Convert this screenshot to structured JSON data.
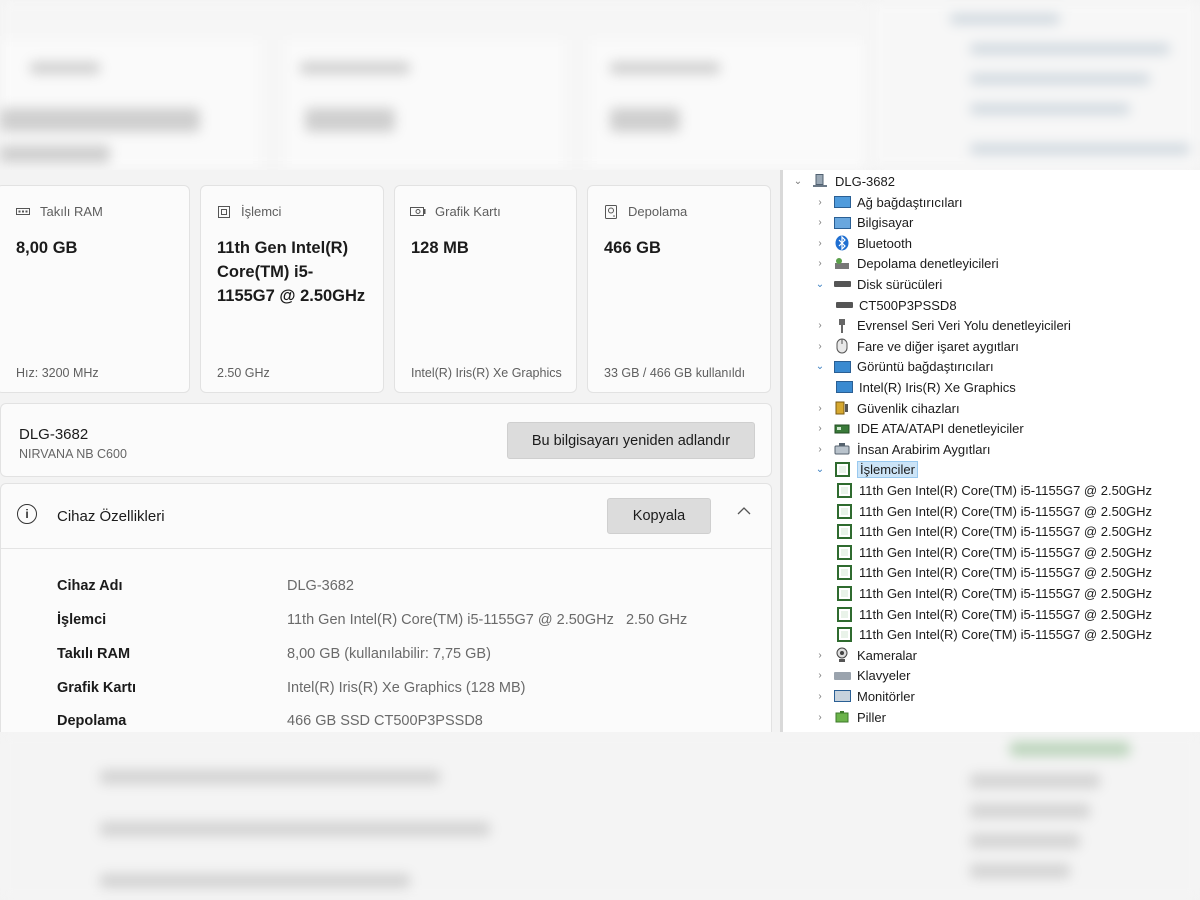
{
  "cards": [
    {
      "icon": "ram-icon",
      "label": "Takılı RAM",
      "value": "8,00 GB",
      "footer": "Hız: 3200 MHz"
    },
    {
      "icon": "processor-icon",
      "label": "İşlemci",
      "value": "11th Gen Intel(R) Core(TM) i5-1155G7 @ 2.50GHz",
      "footer": "2.50 GHz"
    },
    {
      "icon": "graphics-card-icon",
      "label": "Grafik Kartı",
      "value": "128 MB",
      "footer": "Intel(R) Iris(R) Xe Graphics"
    },
    {
      "icon": "storage-icon",
      "label": "Depolama",
      "value": "466 GB",
      "footer": "33 GB / 466 GB kullanıldı"
    }
  ],
  "device": {
    "name": "DLG-3682",
    "model": "NIRVANA NB C600",
    "rename_label": "Bu bilgisayarı yeniden adlandır"
  },
  "specs": {
    "title": "Cihaz Özellikleri",
    "copy_label": "Kopyala",
    "rows": [
      {
        "key": "Cihaz Adı",
        "value": "DLG-3682"
      },
      {
        "key": "İşlemci",
        "value": "11th Gen Intel(R) Core(TM) i5-1155G7 @ 2.50GHz   2.50 GHz"
      },
      {
        "key": "Takılı RAM",
        "value": "8,00 GB (kullanılabilir: 7,75 GB)"
      },
      {
        "key": "Grafik Kartı",
        "value": "Intel(R) Iris(R) Xe Graphics (128 MB)"
      },
      {
        "key": "Depolama",
        "value": "466 GB SSD CT500P3PSSD8"
      }
    ]
  },
  "device_manager": {
    "root": "DLG-3682",
    "items": [
      {
        "label": "Ağ bağdaştırıcıları",
        "level": 1,
        "expanded": false,
        "icon": "network-adapter-icon"
      },
      {
        "label": "Bilgisayar",
        "level": 1,
        "expanded": false,
        "icon": "computer-icon"
      },
      {
        "label": "Bluetooth",
        "level": 1,
        "expanded": false,
        "icon": "bluetooth-icon"
      },
      {
        "label": "Depolama denetleyicileri",
        "level": 1,
        "expanded": false,
        "icon": "storage-controller-icon"
      },
      {
        "label": "Disk sürücüleri",
        "level": 1,
        "expanded": true,
        "icon": "disk-drive-icon"
      },
      {
        "label": "CT500P3PSSD8",
        "level": 2,
        "icon": "disk-drive-icon"
      },
      {
        "label": "Evrensel Seri Veri Yolu denetleyicileri",
        "level": 1,
        "expanded": false,
        "icon": "usb-icon"
      },
      {
        "label": "Fare ve diğer işaret aygıtları",
        "level": 1,
        "expanded": false,
        "icon": "mouse-icon"
      },
      {
        "label": "Görüntü bağdaştırıcıları",
        "level": 1,
        "expanded": true,
        "icon": "display-adapter-icon"
      },
      {
        "label": "Intel(R) Iris(R) Xe Graphics",
        "level": 2,
        "icon": "display-adapter-icon"
      },
      {
        "label": "Güvenlik cihazları",
        "level": 1,
        "expanded": false,
        "icon": "security-device-icon"
      },
      {
        "label": "IDE ATA/ATAPI denetleyiciler",
        "level": 1,
        "expanded": false,
        "icon": "ide-controller-icon"
      },
      {
        "label": "İnsan Arabirim Aygıtları",
        "level": 1,
        "expanded": false,
        "icon": "hid-icon"
      },
      {
        "label": "İşlemciler",
        "level": 1,
        "expanded": true,
        "selected": true,
        "icon": "processor-icon"
      },
      {
        "label": "11th Gen Intel(R) Core(TM) i5-1155G7 @ 2.50GHz",
        "level": 2,
        "icon": "processor-icon"
      },
      {
        "label": "11th Gen Intel(R) Core(TM) i5-1155G7 @ 2.50GHz",
        "level": 2,
        "icon": "processor-icon"
      },
      {
        "label": "11th Gen Intel(R) Core(TM) i5-1155G7 @ 2.50GHz",
        "level": 2,
        "icon": "processor-icon"
      },
      {
        "label": "11th Gen Intel(R) Core(TM) i5-1155G7 @ 2.50GHz",
        "level": 2,
        "icon": "processor-icon"
      },
      {
        "label": "11th Gen Intel(R) Core(TM) i5-1155G7 @ 2.50GHz",
        "level": 2,
        "icon": "processor-icon"
      },
      {
        "label": "11th Gen Intel(R) Core(TM) i5-1155G7 @ 2.50GHz",
        "level": 2,
        "icon": "processor-icon"
      },
      {
        "label": "11th Gen Intel(R) Core(TM) i5-1155G7 @ 2.50GHz",
        "level": 2,
        "icon": "processor-icon"
      },
      {
        "label": "11th Gen Intel(R) Core(TM) i5-1155G7 @ 2.50GHz",
        "level": 2,
        "icon": "processor-icon"
      },
      {
        "label": "Kameralar",
        "level": 1,
        "expanded": false,
        "icon": "camera-icon"
      },
      {
        "label": "Klavyeler",
        "level": 1,
        "expanded": false,
        "icon": "keyboard-icon"
      },
      {
        "label": "Monitörler",
        "level": 1,
        "expanded": false,
        "icon": "monitor-icon"
      },
      {
        "label": "Piller",
        "level": 1,
        "expanded": false,
        "icon": "battery-icon"
      }
    ]
  }
}
